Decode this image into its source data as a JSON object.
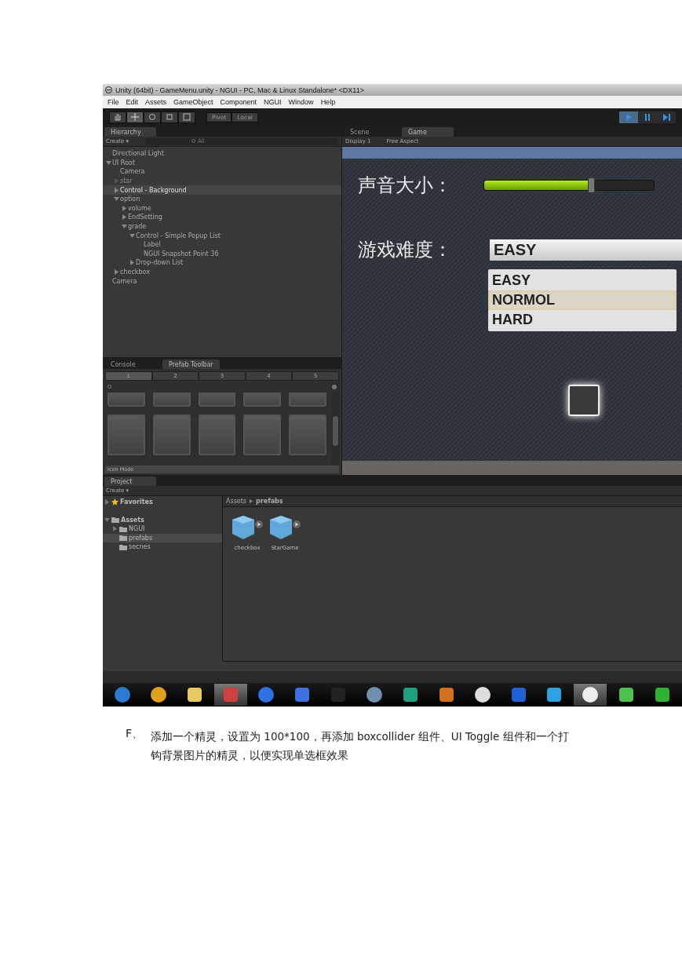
{
  "window": {
    "title": "Unity (64bit) - GameMenu.unity - NGUI - PC, Mac & Linux Standalone* <DX11>"
  },
  "menu": [
    "File",
    "Edit",
    "Assets",
    "GameObject",
    "Component",
    "NGUI",
    "Window",
    "Help"
  ],
  "toolbar": {
    "pivot": "Pivot",
    "local": "Local"
  },
  "hierarchy": {
    "tab": {
      "label": "Hierarchy",
      "selected": true
    },
    "create": "Create ▾",
    "search": {
      "placeholder": "All"
    },
    "items": [
      {
        "label": "Directional Light",
        "selected": false,
        "active": true
      },
      {
        "label": "UI Root",
        "selected": false,
        "active": true,
        "expanded": true,
        "children": [
          {
            "label": "Camera",
            "selected": false,
            "active": true
          },
          {
            "label": "star",
            "selected": false,
            "active": false,
            "expanded": false
          },
          {
            "label": "Control - Background",
            "selected": true,
            "active": true,
            "expanded": false
          },
          {
            "label": "option",
            "selected": false,
            "active": true,
            "expanded": true,
            "children": [
              {
                "label": "volume",
                "selected": false,
                "active": true,
                "expanded": false
              },
              {
                "label": "EndSetting",
                "selected": false,
                "active": true,
                "expanded": false
              },
              {
                "label": "grade",
                "selected": false,
                "active": true,
                "expanded": true,
                "children": [
                  {
                    "label": "Control - Simple Popup List",
                    "selected": false,
                    "active": true,
                    "expanded": true,
                    "children": [
                      {
                        "label": "Label",
                        "selected": false,
                        "active": true
                      },
                      {
                        "label": "NGUI Snapshot Point 36",
                        "selected": false,
                        "active": true
                      }
                    ]
                  },
                  {
                    "label": "Drop-down List",
                    "selected": false,
                    "active": true,
                    "expanded": false
                  }
                ]
              }
            ]
          },
          {
            "label": "checkbox",
            "selected": false,
            "active": true,
            "expanded": false
          }
        ]
      },
      {
        "label": "Camera",
        "selected": false,
        "active": true
      }
    ]
  },
  "bottom_tabs": [
    {
      "label": "Console",
      "selected": false
    },
    {
      "label": "Prefab Toolbar",
      "selected": true
    }
  ],
  "prefab_toolbar": {
    "pages": [
      {
        "label": "1",
        "selected": true
      },
      {
        "label": "2",
        "selected": false
      },
      {
        "label": "3",
        "selected": false
      },
      {
        "label": "4",
        "selected": false
      },
      {
        "label": "5",
        "selected": false
      }
    ],
    "mode": "Icon Mode"
  },
  "view_tabs": [
    {
      "label": "Scene",
      "selected": false
    },
    {
      "label": "Game",
      "selected": true
    }
  ],
  "game_toolbar": {
    "display": "Display 1",
    "aspect": "Free Aspect"
  },
  "game": {
    "volume_label": "声音大小：",
    "volume": {
      "level": 0.63
    },
    "difficulty_label": "游戏难度：",
    "dropdown": {
      "value": "EASY"
    },
    "options": [
      {
        "label": "EASY",
        "selected": false
      },
      {
        "label": "NORMOL",
        "selected": true
      },
      {
        "label": "HARD",
        "selected": false
      }
    ],
    "checkbox": {
      "checked": false
    }
  },
  "project": {
    "tab": {
      "label": "Project",
      "selected": true
    },
    "create": "Create ▾",
    "favorites": "Favorites",
    "assets": "Assets",
    "folders": [
      {
        "label": "NGUI",
        "selected": false,
        "expanded": false
      },
      {
        "label": "prefabs",
        "selected": true
      },
      {
        "label": "secnes",
        "selected": false
      }
    ],
    "breadcrumb": [
      "Assets",
      "prefabs"
    ],
    "files": [
      {
        "label": "checkbox"
      },
      {
        "label": "StarGame"
      }
    ]
  },
  "caption": {
    "marker": "F、",
    "text": "添加一个精灵，设置为 100*100，再添加 boxcollider 组件、UI Toggle 组件和一个打钩背景图片的精灵，以便实现单选框效果"
  }
}
